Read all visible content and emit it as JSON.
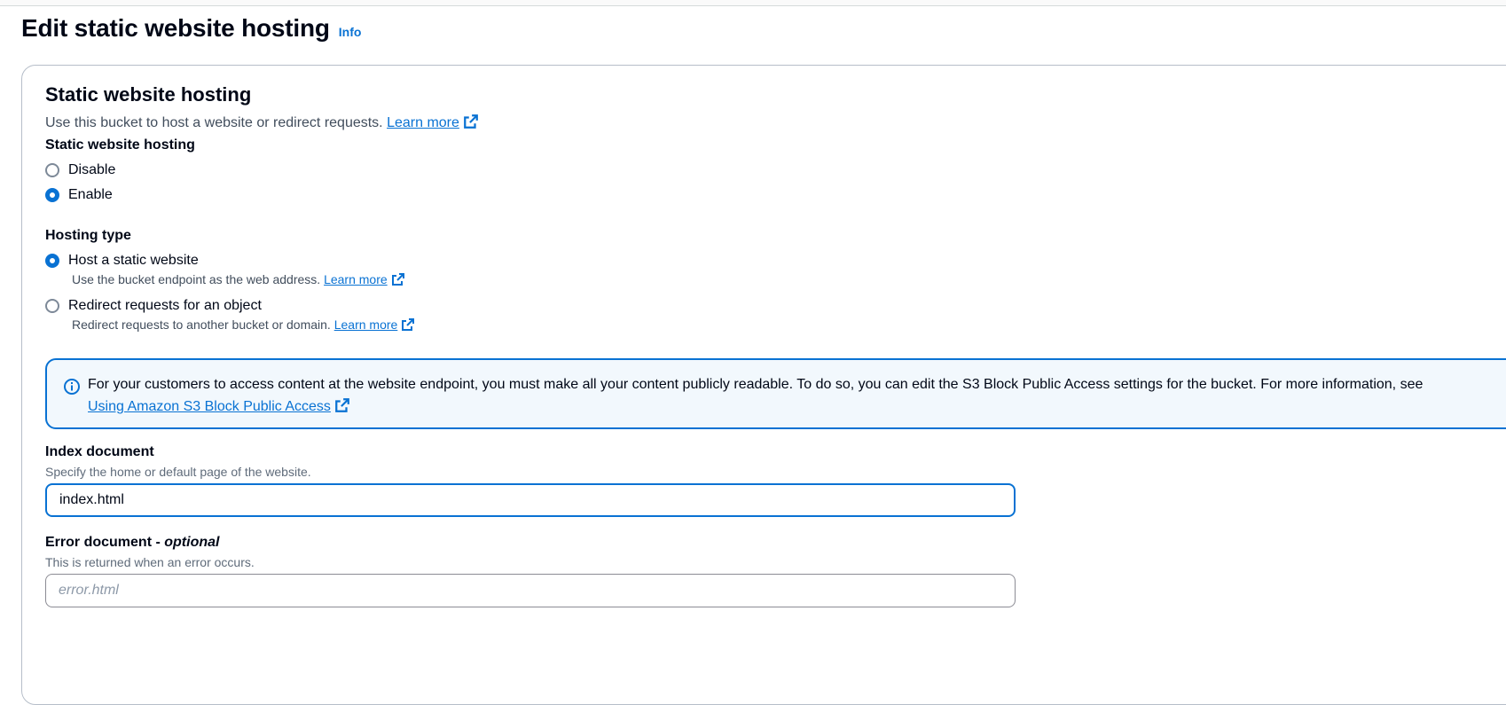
{
  "page": {
    "title": "Edit static website hosting",
    "info_label": "Info"
  },
  "section": {
    "title": "Static website hosting",
    "description": "Use this bucket to host a website or redirect requests.",
    "learn_more": "Learn more"
  },
  "hosting_toggle": {
    "label": "Static website hosting",
    "options": [
      {
        "label": "Disable",
        "checked": false
      },
      {
        "label": "Enable",
        "checked": true
      }
    ]
  },
  "hosting_type": {
    "label": "Hosting type",
    "options": [
      {
        "label": "Host a static website",
        "description": "Use the bucket endpoint as the web address.",
        "learn_more": "Learn more",
        "checked": true
      },
      {
        "label": "Redirect requests for an object",
        "description": "Redirect requests to another bucket or domain.",
        "learn_more": "Learn more",
        "checked": false
      }
    ]
  },
  "alert": {
    "text": "For your customers to access content at the website endpoint, you must make all your content publicly readable. To do so, you can edit the S3 Block Public Access settings for the bucket. For more information, see",
    "link": "Using Amazon S3 Block Public Access"
  },
  "index_document": {
    "label": "Index document",
    "hint": "Specify the home or default page of the website.",
    "value": "index.html"
  },
  "error_document": {
    "label": "Error document -",
    "label_optional": "optional",
    "hint": "This is returned when an error occurs.",
    "placeholder": "error.html",
    "value": ""
  },
  "colors": {
    "link": "#0972d3",
    "text": "#000716",
    "alert_bg": "#f2f8fd"
  }
}
